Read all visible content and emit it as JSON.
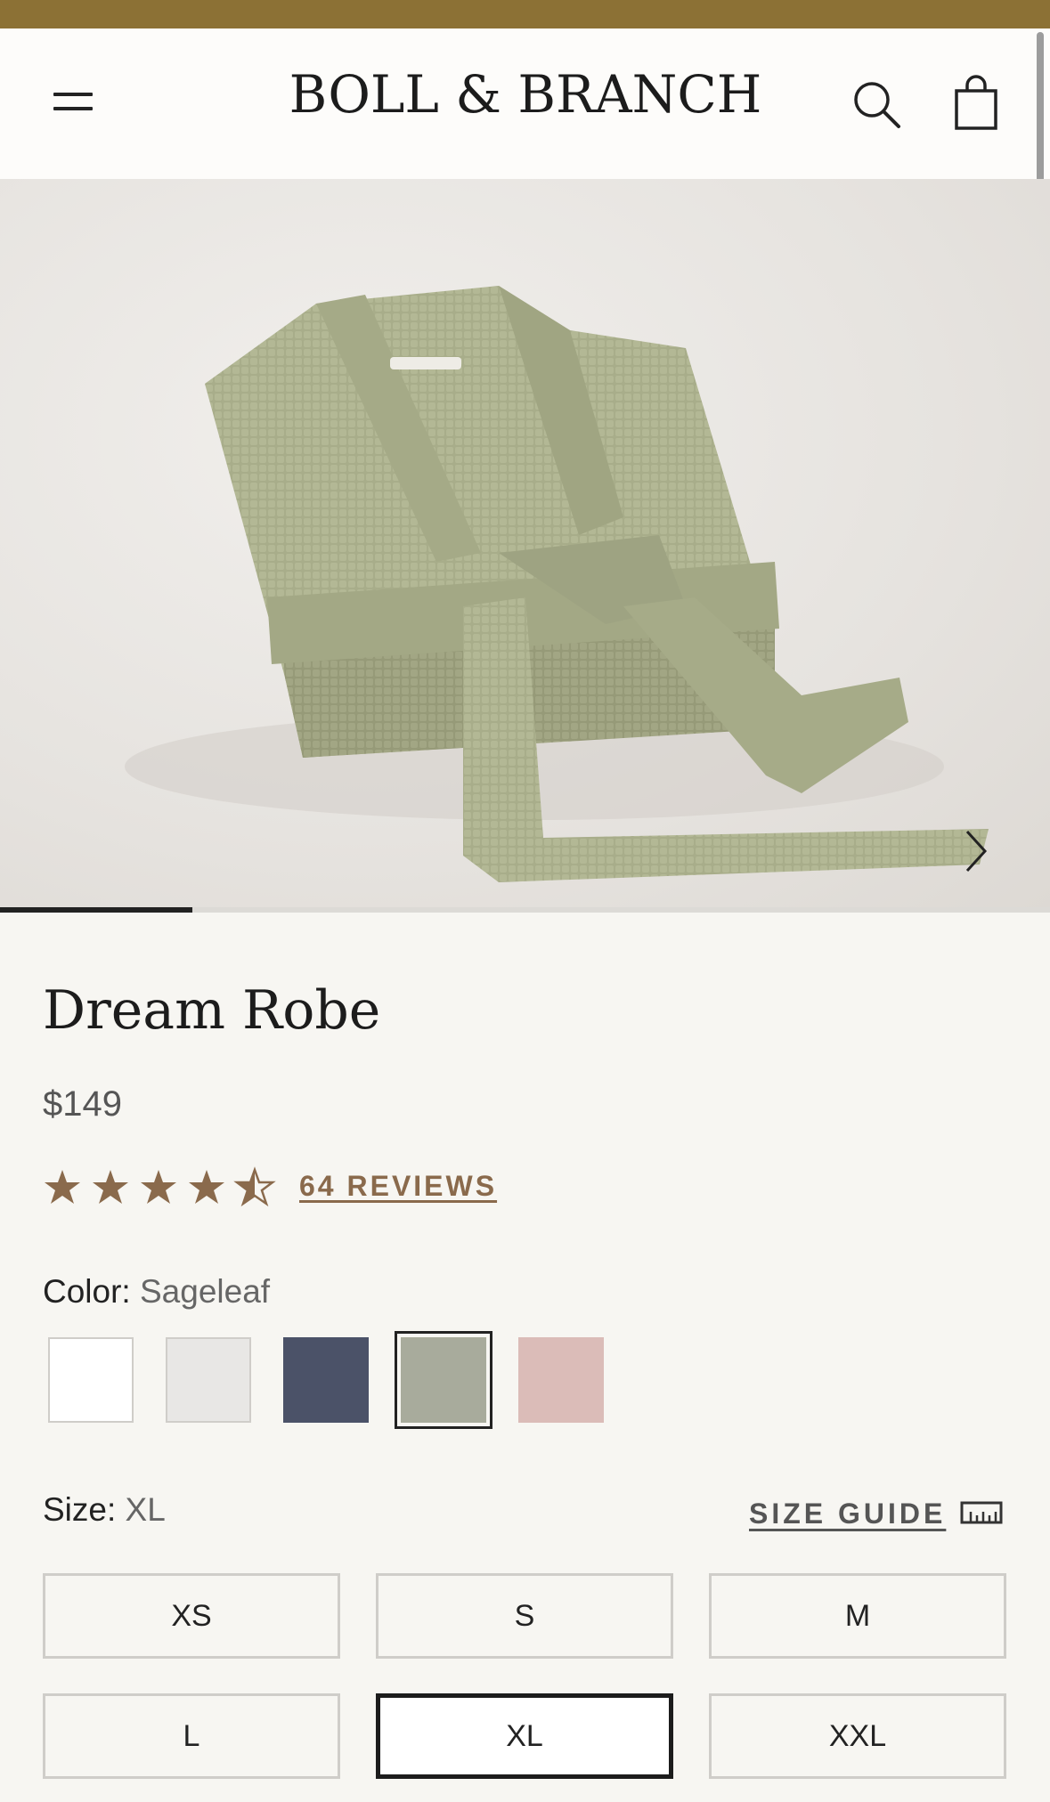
{
  "header": {
    "brand": "BOLL & BRANCH",
    "menu_icon": "hamburger-menu-icon",
    "search_icon": "search-icon",
    "cart_icon": "shopping-bag-icon"
  },
  "gallery": {
    "next_icon": "chevron-right-icon",
    "progress_fraction": 0.18
  },
  "product": {
    "title": "Dream Robe",
    "price": "$149",
    "rating": 4.5,
    "reviews_label": "64 REVIEWS"
  },
  "color": {
    "label": "Color:",
    "selected": "Sageleaf",
    "swatches": [
      {
        "hex": "#ffffff"
      },
      {
        "hex": "#e8e7e5"
      },
      {
        "hex": "#4b5268"
      },
      {
        "hex": "#a8ab9c",
        "selected": true
      },
      {
        "hex": "#dbbcb8"
      }
    ]
  },
  "size": {
    "label": "Size:",
    "selected": "XL",
    "guide_label": "SIZE GUIDE",
    "guide_icon": "ruler-icon",
    "options": [
      "XS",
      "S",
      "M",
      "L",
      "XL",
      "XXL"
    ]
  },
  "colors": {
    "announcement_bar": "#8c7135",
    "accent_brown": "#8a6a4c",
    "star": "#8a6a4c"
  }
}
